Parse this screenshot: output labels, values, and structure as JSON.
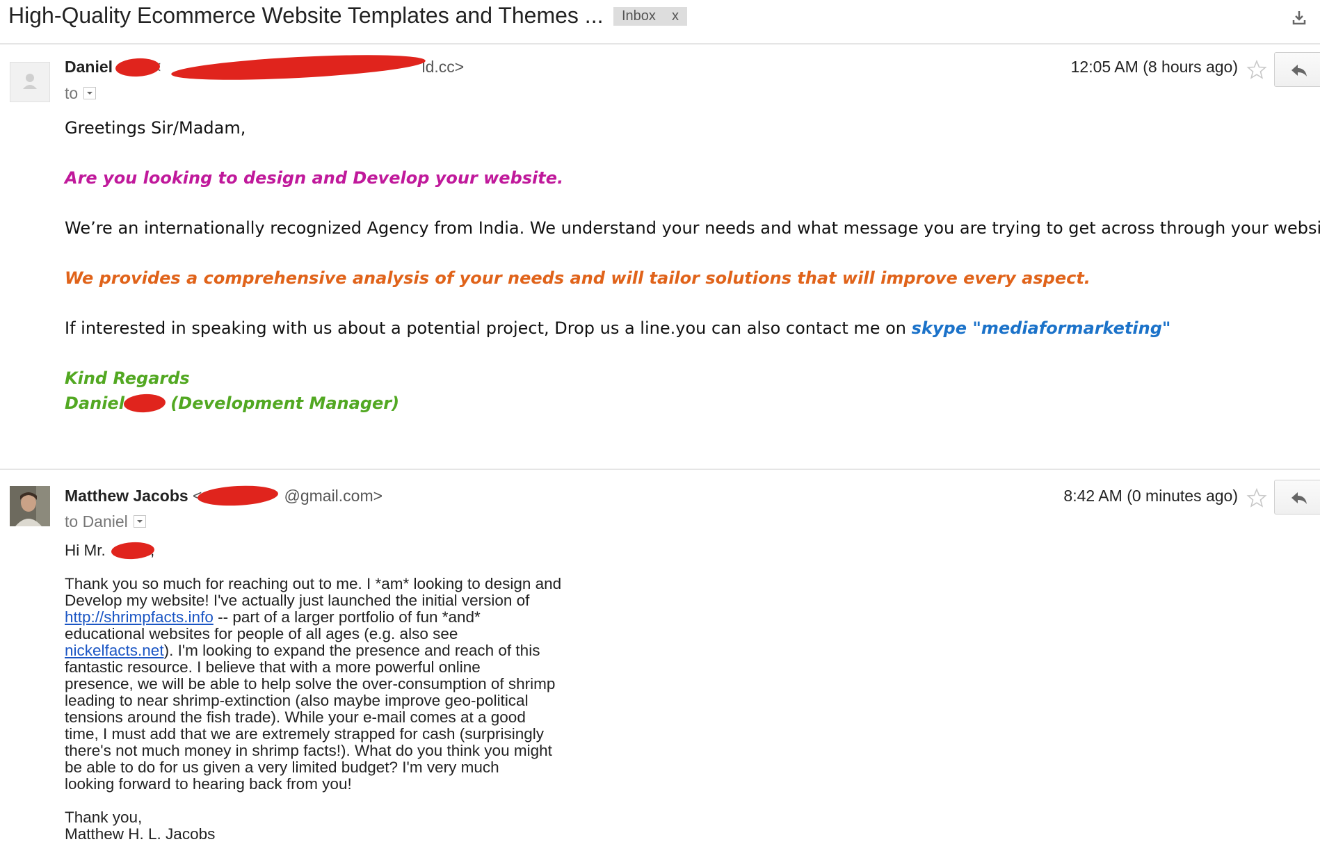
{
  "thread": {
    "subject": "High-Quality Ecommerce Website Templates and Themes ...",
    "label": "Inbox",
    "label_remove": "x"
  },
  "message1": {
    "sender_name": "Daniel",
    "sender_email_visible": "<",
    "sender_email_tail": "ld.cc>",
    "to_label": "to",
    "timestamp": "12:05 AM (8 hours ago)",
    "greeting": "Greetings Sir/Madam,",
    "line_question": "Are you looking to design and Develop your website.",
    "line_intro": "We’re an internationally recognized Agency from India. We understand your needs and what message you are trying to get across through your website.",
    "line_offer": "We provides a comprehensive analysis of your needs and will tailor solutions that will improve every aspect.",
    "line_contact": "If interested in speaking with us about a potential project, Drop us a line.you can also contact me on ",
    "line_skype": "skype \"mediaformarketing\"",
    "sign_regards": "Kind Regards",
    "sign_name": "Daniel ",
    "sign_title": "(Development Manager)",
    "colors": {
      "magenta": "#c0199b",
      "orange": "#e0631a",
      "blue": "#1b72c9",
      "green": "#52a822"
    }
  },
  "message2": {
    "sender_name": "Matthew Jacobs",
    "sender_email_visible": "<",
    "sender_email_tail": "@gmail.com>",
    "to_label": "to Daniel",
    "timestamp": "8:42 AM (0 minutes ago)",
    "greeting": "Hi Mr. ",
    "greeting_tail": ",",
    "para1_a": "Thank you so much for reaching out to me. I *am* looking to design and\nDevelop my website! I've actually just launched the initial version of\n",
    "link1": "http://shrimpfacts.info",
    "para1_b": " -- part of a larger portfolio of fun *and*\neducational websites for people of all ages (e.g. also see\n",
    "link2": "nickelfacts.net",
    "para1_c": "). I'm looking to expand the presence and reach of this\nfantastic resource. I believe that with a more powerful online\npresence, we will be able to help solve the over-consumption of shrimp\nleading to near shrimp-extinction (also maybe improve geo-political\ntensions around the fish trade). While your e-mail comes at a good\ntime, I must add that we are extremely strapped for cash (surprisingly\nthere's not much money in shrimp facts!). What do you think you might\nbe able to do for us given a very limited budget? I'm very much\nlooking forward to hearing back from you!",
    "closing": "Thank you,",
    "signature": "Matthew H. L. Jacobs"
  },
  "icons": {
    "download": "download-icon",
    "star": "star-icon",
    "reply": "reply-icon",
    "dropdown": "chevron-down-icon",
    "avatar_default": "person-icon"
  }
}
